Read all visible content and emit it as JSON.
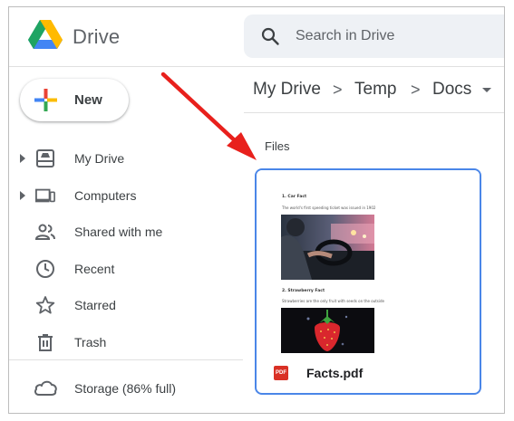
{
  "app": {
    "name": "Drive"
  },
  "search": {
    "placeholder": "Search in Drive"
  },
  "sidebar": {
    "new_label": "New",
    "items": [
      {
        "label": "My Drive",
        "icon": "my-drive-icon"
      },
      {
        "label": "Computers",
        "icon": "computers-icon"
      },
      {
        "label": "Shared with me",
        "icon": "shared-icon"
      },
      {
        "label": "Recent",
        "icon": "clock-icon"
      },
      {
        "label": "Starred",
        "icon": "star-icon"
      },
      {
        "label": "Trash",
        "icon": "trash-icon"
      }
    ],
    "storage_label": "Storage (86% full)"
  },
  "breadcrumb": {
    "items": [
      "My Drive",
      "Temp",
      "Docs"
    ],
    "separator": ">"
  },
  "main": {
    "section_title": "Files",
    "file": {
      "name": "Facts.pdf",
      "type_badge": "PDF",
      "preview": {
        "heading1": "1. Car Fact",
        "text1": "The world's first speeding ticket was issued in 1902",
        "heading2": "2. Strawberry Fact",
        "text2": "Strawberries are the only fruit with seeds on the outside"
      }
    }
  },
  "colors": {
    "arrow": "#e8201c",
    "selection_border": "#4a86e8",
    "search_bg": "#eef1f5"
  }
}
